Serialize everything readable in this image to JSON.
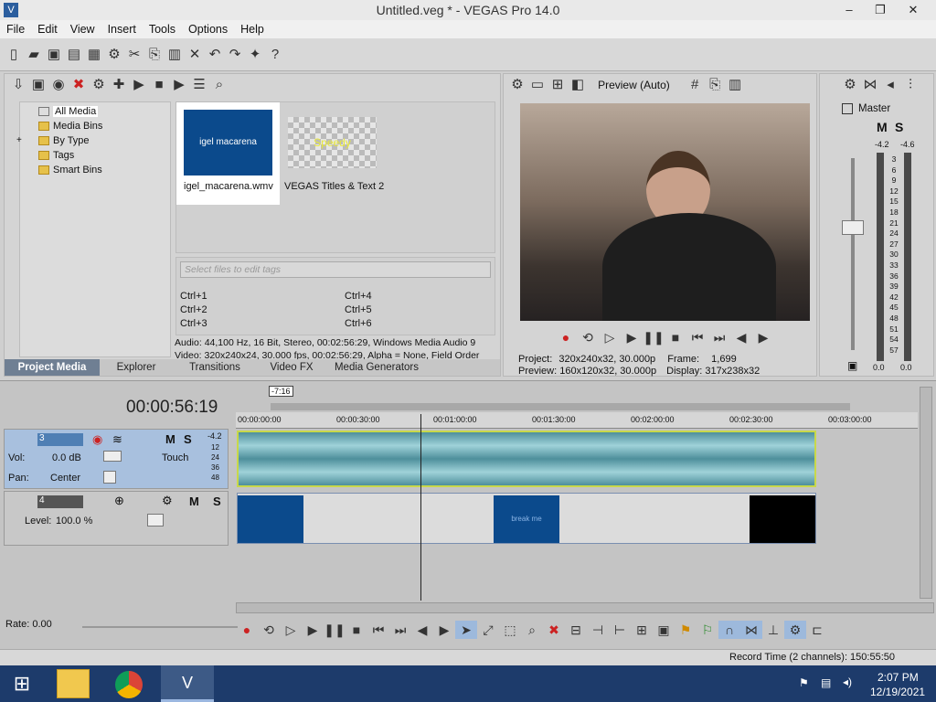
{
  "window": {
    "title": "Untitled.veg * - VEGAS Pro 14.0",
    "minimize": "–",
    "restore": "❐",
    "close": "✕"
  },
  "menu": [
    "File",
    "Edit",
    "View",
    "Insert",
    "Tools",
    "Options",
    "Help"
  ],
  "project_media": {
    "tree": [
      "All Media",
      "Media Bins",
      "By Type",
      "Tags",
      "Smart Bins"
    ],
    "tree_expander": "+",
    "thumbs": [
      {
        "name": "igel_macarena.wmv",
        "thumb_text": "igel macarena"
      },
      {
        "name": "VEGAS Titles & Text 2",
        "thumb_text": "Speedy"
      }
    ],
    "tags_placeholder": "Select files to edit tags",
    "shortcuts": [
      "Ctrl+1",
      "Ctrl+4",
      "Ctrl+2",
      "Ctrl+5",
      "Ctrl+3",
      "Ctrl+6"
    ],
    "info_audio": "Audio: 44,100 Hz, 16 Bit, Stereo, 00:02:56:29, Windows Media Audio 9",
    "info_video": "Video: 320x240x24, 30.000 fps, 00:02:56:29, Alpha = None, Field Order"
  },
  "tabs": [
    "Project Media",
    "Explorer",
    "Transitions",
    "Video FX",
    "Media Generators"
  ],
  "preview": {
    "mode": "Preview (Auto)",
    "project_label": "Project:",
    "project_value": "320x240x32, 30.000p",
    "preview_label": "Preview:",
    "preview_value": "160x120x32, 30.000p",
    "frame_label": "Frame:",
    "frame_value": "1,699",
    "display_label": "Display:",
    "display_value": "317x238x32"
  },
  "master": {
    "label": "Master",
    "peak_left": "-4.2",
    "peak_right": "-4.6",
    "scale": [
      "3",
      "6",
      "9",
      "12",
      "15",
      "18",
      "21",
      "24",
      "27",
      "30",
      "33",
      "36",
      "39",
      "42",
      "45",
      "48",
      "51",
      "54",
      "57"
    ],
    "bottom_left": "0.0",
    "bottom_right": "0.0",
    "m": "M",
    "s": "S"
  },
  "timeline": {
    "time": "00:00:56:19",
    "loop_badge": "-7:16",
    "ruler": [
      "00:00:00:00",
      "00:00:30:00",
      "00:01:00:00",
      "00:01:30:00",
      "00:02:00:00",
      "00:02:30:00",
      "00:03:00:00"
    ],
    "track3": {
      "num": "3",
      "vol_label": "Vol:",
      "vol_value": "0.0 dB",
      "pan_label": "Pan:",
      "pan_value": "Center",
      "touch": "Touch",
      "peak": "-4.2",
      "meter": [
        "12",
        "24",
        "36",
        "48"
      ]
    },
    "track4": {
      "num": "4",
      "level_label": "Level:",
      "level_value": "100.0 %"
    },
    "clip_text": "break me",
    "rate": "Rate: 0.00",
    "record_time": "Record Time (2 channels): 150:55:50"
  },
  "taskbar": {
    "time": "2:07 PM",
    "date": "12/19/2021"
  }
}
